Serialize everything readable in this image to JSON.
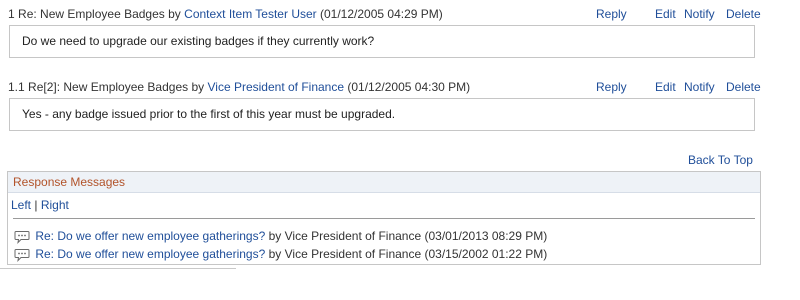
{
  "posts": [
    {
      "number": "1",
      "title": "Re: New Employee Badges",
      "by": "by",
      "author": "Context Item Tester User",
      "date": "(01/12/2005 04:29 PM)",
      "body": "Do we need to upgrade our existing badges if they currently work?"
    },
    {
      "number": "1.1",
      "title": "Re[2]: New Employee Badges",
      "by": "by",
      "author": "Vice President of Finance",
      "date": "(01/12/2005 04:30 PM)",
      "body": "Yes - any badge issued prior to the first of this year must be upgraded."
    }
  ],
  "actions": {
    "reply": "Reply",
    "edit": "Edit",
    "notify": "Notify",
    "delete": "Delete"
  },
  "back_to_top": "Back To Top",
  "response_panel": {
    "title": "Response Messages",
    "left": "Left",
    "separator": "|",
    "right": "Right",
    "items": [
      {
        "subject": "Re: Do we offer new employee gatherings?",
        "by": "by Vice President of Finance",
        "date": "(03/01/2013 08:29 PM)",
        "icon": "speech-bubble-icon"
      },
      {
        "subject": "Re: Do we offer new employee gatherings?",
        "by": "by Vice President of Finance",
        "date": "(03/15/2002 01:22 PM)",
        "icon": "speech-bubble-icon"
      }
    ]
  },
  "colors": {
    "link": "#1f4e99",
    "panel_title": "#b2532a",
    "border": "#c6c6c6"
  }
}
